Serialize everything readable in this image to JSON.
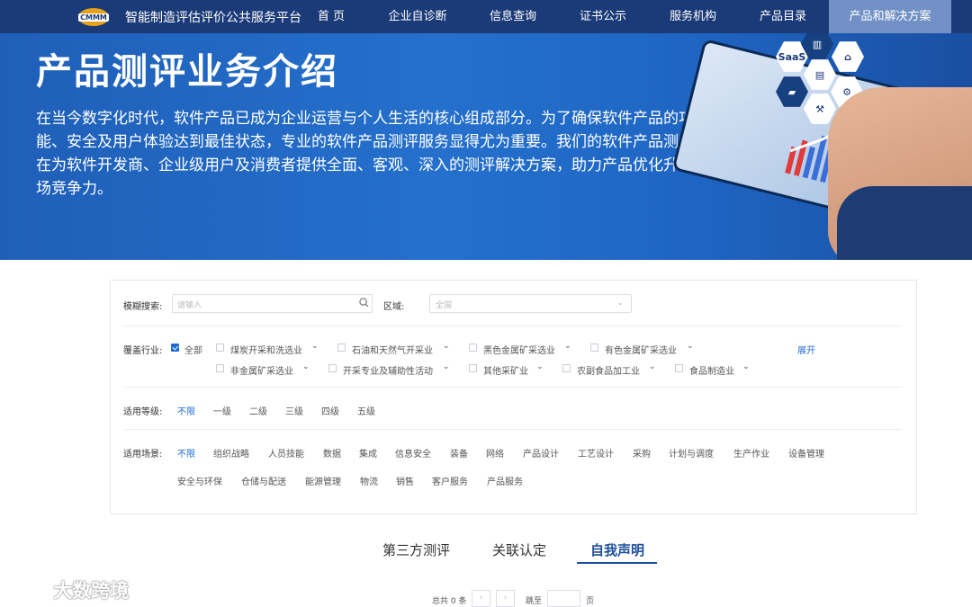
{
  "nav": {
    "logo_text": "CMMM",
    "platform_title": "智能制造评估评价公共服务平台",
    "items": [
      "首 页",
      "企业自诊断",
      "信息查询",
      "证书公示",
      "服务机构",
      "产品目录",
      "产品和解决方案"
    ]
  },
  "banner": {
    "title": "产品测评业务介绍",
    "description": "在当今数字化时代，软件产品已成为企业运营与个人生活的核心组成部分。为了确保软件产品的功能、性能、安全及用户体验达到最佳状态，专业的软件产品测评服务显得尤为重要。我们的软件产品测评业务，旨在为软件开发商、企业级用户及消费者提供全面、客观、深入的测评解决方案，助力产品优化升级，提升市场竞争力。",
    "hex_saas": "SaaS"
  },
  "filters": {
    "search_label": "模糊搜索:",
    "search_placeholder": "请输入",
    "region_label": "区域:",
    "region_value": "全国",
    "industry_label": "覆盖行业:",
    "industry_all": "全部",
    "industries": [
      "煤炭开采和洗选业",
      "石油和天然气开采业",
      "黑色金属矿采选业",
      "有色金属矿采选业",
      "非金属矿采选业",
      "开采专业及辅助性活动",
      "其他采矿业",
      "农副食品加工业",
      "食品制造业"
    ],
    "expand_label": "展开",
    "level_label": "适用等级:",
    "levels": [
      "不限",
      "一级",
      "二级",
      "三级",
      "四级",
      "五级"
    ],
    "scene_label": "适用场景:",
    "scenes_row1": [
      "不限",
      "组织战略",
      "人员技能",
      "数据",
      "集成",
      "信息安全",
      "装备",
      "网络",
      "产品设计",
      "工艺设计",
      "采购",
      "计划与调度",
      "生产作业",
      "设备管理"
    ],
    "scenes_row2": [
      "安全与环保",
      "仓储与配送",
      "能源管理",
      "物流",
      "销售",
      "客户服务",
      "产品服务"
    ]
  },
  "tabs": [
    "第三方测评",
    "关联认定",
    "自我声明"
  ],
  "pagination": {
    "total": "总共 0 条",
    "prev": "‹",
    "next": "›",
    "goto": "跳至",
    "page_unit": "页"
  },
  "watermark": "大数跨境"
}
